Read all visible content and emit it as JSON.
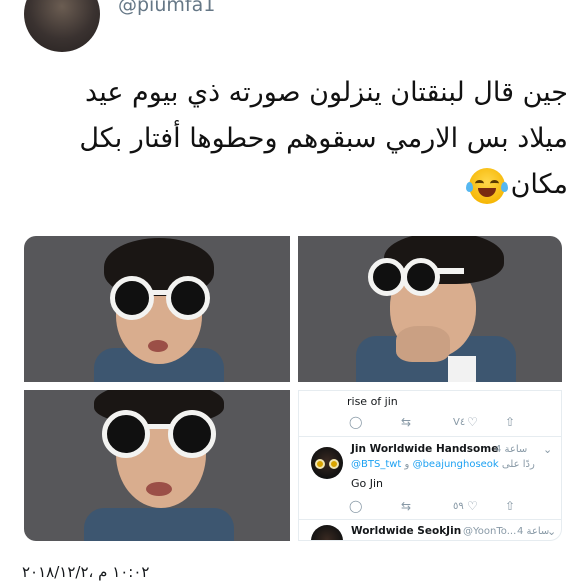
{
  "header": {
    "handle": "@piumfa1"
  },
  "tweet": {
    "lines": [
      "جين قال لبنقتان ينزلون صورته ذي بيوم عيد",
      "ميلاد بس الارمي سبقوهم وحطوها أفتار بكل",
      "مكان"
    ],
    "emoji": "face-with-tears-of-joy-icon"
  },
  "embedded": {
    "top_text": "rise of jin",
    "top_like_count": "V٤",
    "reply1": {
      "name": "Jin Worldwide Handsome",
      "time": "4 ساعة",
      "reply_to_label": "ردًا على",
      "mention1": "@BTS_twt",
      "mention2": "@beajunghoseok",
      "mention_joiner": "و",
      "text": "Go Jin",
      "like_count": "٥٩"
    },
    "reply2": {
      "name": "Worldwide SeokJin",
      "handle": "@YoonTo...",
      "time": "4 ساعة"
    }
  },
  "timestamp": "١٠:٠٢ م ،٢٠١٨/١٢/٢"
}
